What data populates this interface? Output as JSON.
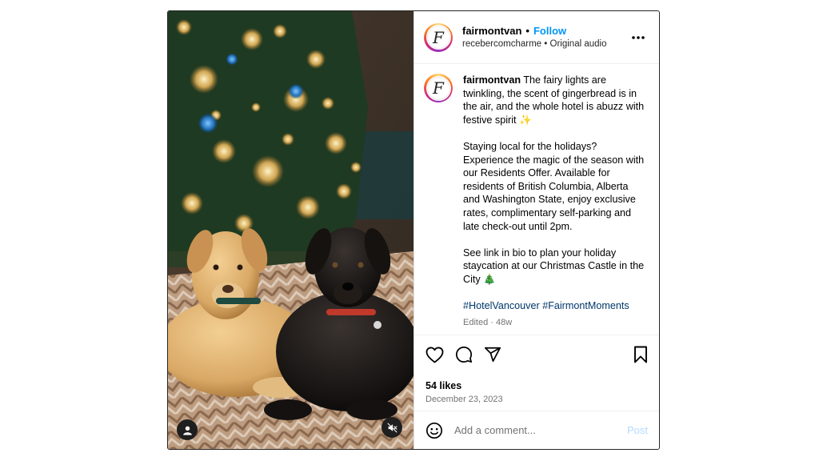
{
  "post": {
    "author": {
      "username": "fairmontvan",
      "avatar_letter": "F",
      "follow_label": "Follow",
      "separator": "•"
    },
    "audio": {
      "source": "recebercomcharme",
      "separator": "•",
      "label": "Original audio"
    },
    "caption": {
      "username": "fairmontvan",
      "paragraph1": "The fairy lights are twinkling, the scent of gingerbread is in the air, and the whole hotel is abuzz with festive spirit ✨",
      "paragraph2": "Staying local for the holidays? Experience the magic of the season with our Residents Offer. Available for residents of British Columbia, Alberta and Washington State, enjoy exclusive rates, complimentary self-parking and late check-out until 2pm.",
      "paragraph3": "See link in bio to plan your holiday staycation at our Christmas Castle in the City 🎄",
      "hashtag1": "#HotelVancouver",
      "hashtag2": "#FairmontMoments",
      "meta": "Edited · 48w"
    },
    "engagement": {
      "likes": "54 likes",
      "date": "December 23, 2023"
    },
    "comment_box": {
      "placeholder": "Add a comment...",
      "post_label": "Post"
    },
    "icons": {
      "more": "more-options-icon",
      "like": "heart-icon",
      "comment": "comment-icon",
      "share": "share-icon",
      "save": "bookmark-icon",
      "emoji": "emoji-icon",
      "tagged_user": "user-icon",
      "mute": "muted-speaker-icon"
    },
    "colors": {
      "follow": "#0095f6",
      "hashtag": "#00376b",
      "post_disabled": "#b3dbff",
      "muted_text": "#737373"
    }
  }
}
